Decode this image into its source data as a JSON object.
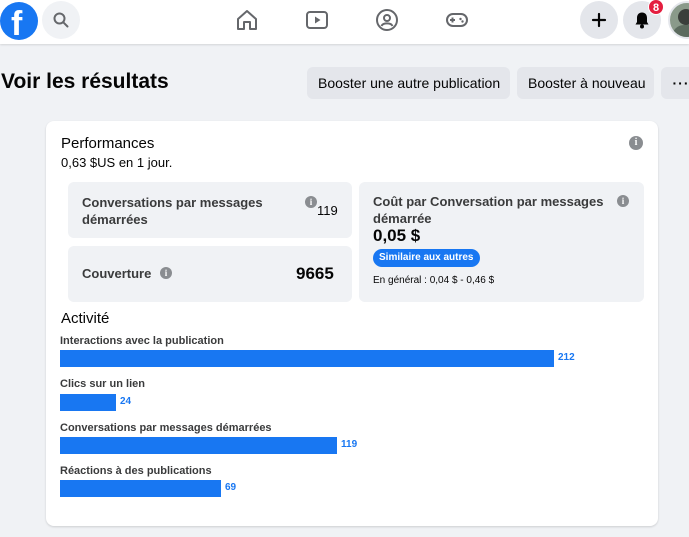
{
  "nav": {
    "logo_letter": "f",
    "notifications_count": "8"
  },
  "header": {
    "title": "Voir les résultats",
    "boost_other_label": "Booster une autre publication",
    "boost_again_label": "Booster à nouveau",
    "more_label": "···"
  },
  "performance": {
    "title": "Performances",
    "spend_amount": "0,63 $US",
    "spend_period": " en 1 jour."
  },
  "metrics": {
    "conversations": {
      "label": "Conversations par messages démarrées",
      "value": "119"
    },
    "reach": {
      "label": "Couverture",
      "value": "9665"
    },
    "cost": {
      "label": "Coût par Conversation par messages démarrée",
      "value": "0,05 $",
      "badge": "Similaire aux autres",
      "range": "En général : 0,04 $ - 0,46 $"
    }
  },
  "activity": {
    "title": "Activité",
    "scale_max": 212,
    "items": [
      {
        "label": "Interactions avec la publication",
        "value": 212
      },
      {
        "label": "Clics sur un lien",
        "value": 24
      },
      {
        "label": "Conversations par messages démarrées",
        "value": 119
      },
      {
        "label": "Réactions à des publications",
        "value": 69
      }
    ]
  },
  "colors": {
    "brand": "#1877f2",
    "badge_red": "#e41e3f",
    "surface": "#f0f2f5"
  },
  "icons": [
    "facebook-logo-icon",
    "search-icon",
    "home-icon",
    "watch-icon",
    "groups-icon",
    "gaming-icon",
    "plus-icon",
    "bell-icon",
    "info-icon"
  ]
}
